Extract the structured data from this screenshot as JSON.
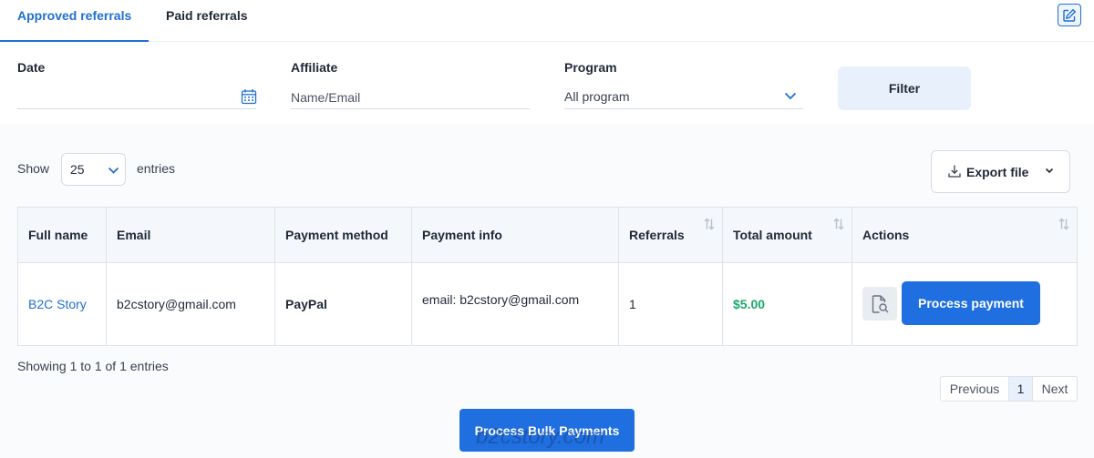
{
  "tabs": [
    {
      "label": "Approved referrals",
      "active": true
    },
    {
      "label": "Paid referrals",
      "active": false
    }
  ],
  "filters": {
    "date_label": "Date",
    "date_value": "",
    "affiliate_label": "Affiliate",
    "affiliate_placeholder": "Name/Email",
    "program_label": "Program",
    "program_value": "All program",
    "filter_button": "Filter"
  },
  "entries": {
    "show_label": "Show",
    "page_size": "25",
    "entries_label": "entries"
  },
  "export": {
    "label": "Export file"
  },
  "table": {
    "columns": [
      "Full name",
      "Email",
      "Payment method",
      "Payment info",
      "Referrals",
      "Total amount",
      "Actions"
    ],
    "rows": [
      {
        "full_name": "B2C Story",
        "email": "b2cstory@gmail.com",
        "payment_method": "PayPal",
        "payment_info": "email: b2cstory@gmail.com",
        "referrals": "1",
        "total_amount": "$5.00",
        "action_label": "Process payment"
      }
    ]
  },
  "summary": "Showing 1 to 1 of 1 entries",
  "pagination": {
    "previous": "Previous",
    "current": "1",
    "next": "Next"
  },
  "bulk_button": "Process Bulk Payments",
  "watermark": "b2cstory.com",
  "colors": {
    "accent": "#1f6fd1",
    "primary_button": "#1f6fe0",
    "amount": "#1aa86b",
    "filter_button_bg": "#e8f1fb"
  }
}
